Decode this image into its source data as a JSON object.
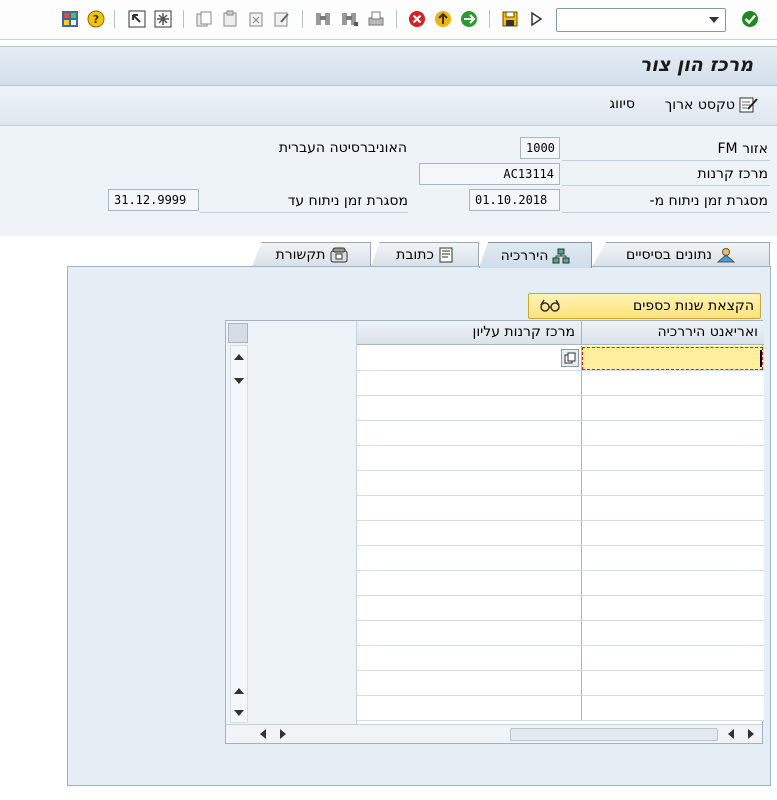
{
  "command_field": {
    "value": ""
  },
  "title": "מרכז הון צור",
  "app_toolbar": {
    "long_text_label": "טקסט ארוך",
    "classification_label": "סיווג"
  },
  "header": {
    "fm_area": {
      "label": "אזור FM",
      "value": "1000",
      "description": "האוניברסיטה העברית"
    },
    "fund_center": {
      "label": "מרכז קרנות",
      "value": "AC13114"
    },
    "valid_from": {
      "label": "מסגרת זמן ניתוח מ-",
      "value": "01.10.2018"
    },
    "valid_to": {
      "label": "מסגרת זמן ניתוח עד",
      "value": "31.12.9999"
    }
  },
  "tabs": [
    {
      "id": "basic",
      "label": "נתונים בסיסיים"
    },
    {
      "id": "hierarchy",
      "label": "היררכיה",
      "active": true
    },
    {
      "id": "address",
      "label": "כתובת"
    },
    {
      "id": "communication",
      "label": "תקשורת"
    }
  ],
  "hierarchy": {
    "fy_button_label": "הקצאת שנות כספים",
    "columns": [
      "ואריאנט היררכיה",
      "מרכז קרנות עליון"
    ],
    "rows": [
      [
        "",
        ""
      ],
      [
        "",
        ""
      ],
      [
        "",
        ""
      ],
      [
        "",
        ""
      ],
      [
        "",
        ""
      ],
      [
        "",
        ""
      ],
      [
        "",
        ""
      ],
      [
        "",
        ""
      ],
      [
        "",
        ""
      ],
      [
        "",
        ""
      ],
      [
        "",
        ""
      ],
      [
        "",
        ""
      ],
      [
        "",
        ""
      ],
      [
        "",
        ""
      ],
      [
        "",
        ""
      ]
    ]
  },
  "colors": {
    "title_bg": "#d2dee9",
    "tab_panel_bg": "#e6eef5",
    "fy_button_bg": "#ffe27a",
    "active_cell_bg": "#ffef9c"
  }
}
